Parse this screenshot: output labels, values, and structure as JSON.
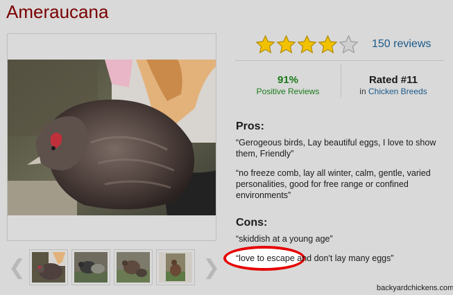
{
  "page": {
    "title": "Ameraucana"
  },
  "rating": {
    "stars": 4,
    "max_stars": 5,
    "reviews_link": "150 reviews"
  },
  "stats": {
    "positive_pct": "91%",
    "positive_label": "Positive Reviews",
    "rank": "Rated #11",
    "rank_prefix": "in",
    "rank_category": "Chicken Breeds"
  },
  "pros": {
    "heading": "Pros:",
    "items": [
      "“Gerogeous birds, Lay beautiful eggs, I love to show them, Friendly”",
      "“no freeze comb, lay all winter, calm, gentle, varied personalities, good for free range or confined environments”"
    ]
  },
  "cons": {
    "heading": "Cons:",
    "items": [
      "“skiddish at a young age”",
      "“love to escape and don't lay many eggs”"
    ]
  },
  "gallery": {
    "prev_arrow": "❮",
    "next_arrow": "❯",
    "thumbnail_count": 4
  },
  "watermark": "backyardchickens.com",
  "colors": {
    "title": "#7a0000",
    "positive": "#1a7a1a",
    "link": "#1c5a8a",
    "star": "#f2c200",
    "highlight": "#e60000"
  }
}
